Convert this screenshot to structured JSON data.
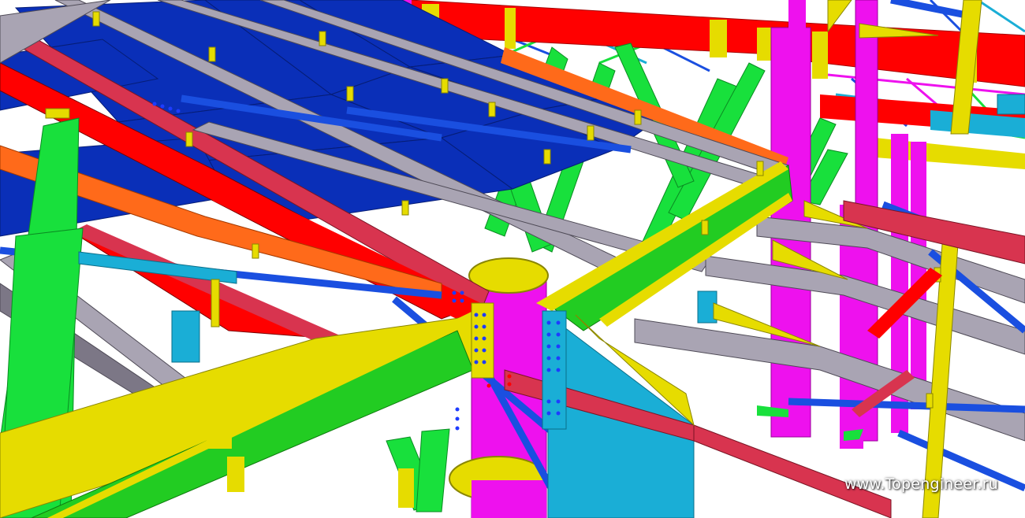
{
  "watermark": {
    "text": "www.Topengineer.ru"
  },
  "palette": {
    "girder_red": "#ff0000",
    "girder_crimson": "#d8344f",
    "deck_blue": "#0a2fb8",
    "brace_blue": "#1a4fe0",
    "purlin_grey": "#a9a4b3",
    "purlin_grey_dark": "#7c7786",
    "column_green": "#18e03c",
    "beam_green": "#22cc22",
    "column_magenta": "#ee11ee",
    "beam_yellow": "#e6dc00",
    "plate_cyan": "#1aaed6",
    "beam_orange": "#ff6a1a",
    "bolt_blue": "#1e3cff"
  }
}
